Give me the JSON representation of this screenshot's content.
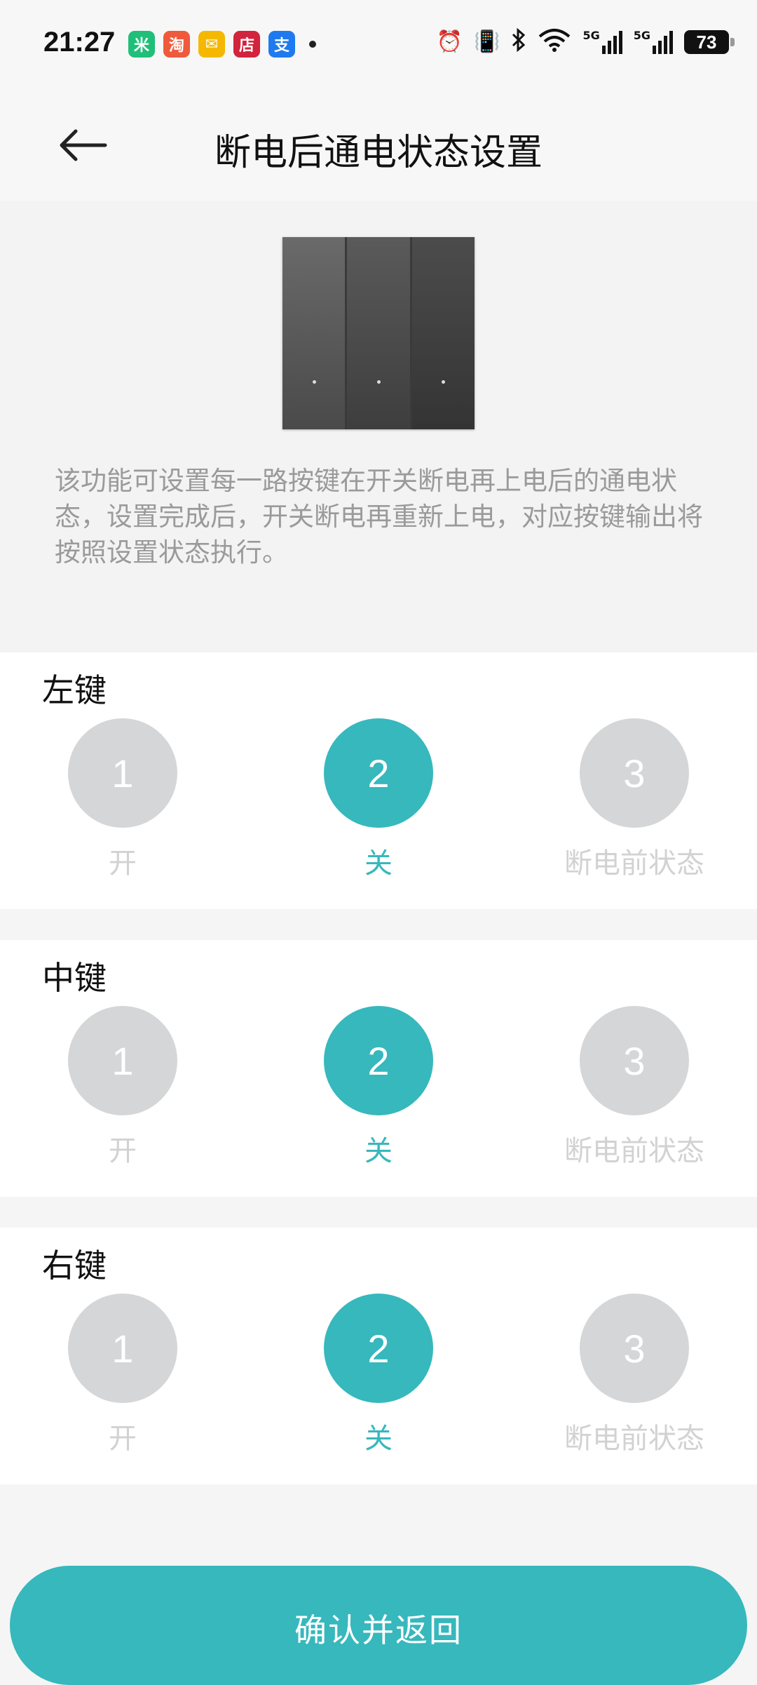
{
  "status_bar": {
    "time": "21:27",
    "notification_icons": [
      "mi-home-icon",
      "taobao-icon",
      "mail-icon",
      "store-icon",
      "alipay-icon"
    ],
    "notification_glyphs": [
      "米",
      "淘",
      "✉",
      "店",
      "支"
    ],
    "notification_colors": [
      "#1fbf7a",
      "#ef5a3c",
      "#f5b800",
      "#d2243c",
      "#1f7aef"
    ],
    "battery": "73",
    "network_labels": [
      "5G",
      "5G"
    ]
  },
  "header": {
    "title": "断电后通电状态设置"
  },
  "intro": {
    "description": "该功能可设置每一路按键在开关断电再上电后的通电状态，设置完成后，开关断电再重新上电，对应按键输出将按照设置状态执行。"
  },
  "keys": [
    {
      "label": "左键",
      "options": [
        {
          "number": "1",
          "label": "开",
          "selected": false
        },
        {
          "number": "2",
          "label": "关",
          "selected": true
        },
        {
          "number": "3",
          "label": "断电前状态",
          "selected": false
        }
      ]
    },
    {
      "label": "中键",
      "options": [
        {
          "number": "1",
          "label": "开",
          "selected": false
        },
        {
          "number": "2",
          "label": "关",
          "selected": true
        },
        {
          "number": "3",
          "label": "断电前状态",
          "selected": false
        }
      ]
    },
    {
      "label": "右键",
      "options": [
        {
          "number": "1",
          "label": "开",
          "selected": false
        },
        {
          "number": "2",
          "label": "关",
          "selected": true
        },
        {
          "number": "3",
          "label": "断电前状态",
          "selected": false
        }
      ]
    }
  ],
  "confirm_label": "确认并返回",
  "colors": {
    "accent": "#36b8bd",
    "unselected": "#d4d6d8"
  }
}
